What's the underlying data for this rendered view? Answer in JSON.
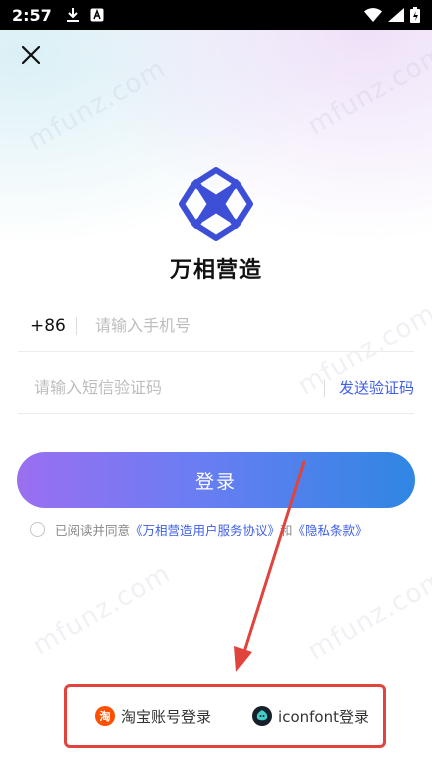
{
  "status_bar": {
    "time": "2:57",
    "left_icons": [
      "download-icon",
      "a-notification-icon"
    ],
    "right_icons": [
      "wifi-icon",
      "signal-icon",
      "battery-icon"
    ]
  },
  "header": {
    "close_icon": "close-icon"
  },
  "brand": {
    "name": "万相营造",
    "logo_color": "#3d4fd6"
  },
  "form": {
    "country_code": "+86",
    "phone_placeholder": "请输入手机号",
    "code_placeholder": "请输入短信验证码",
    "send_code_label": "发送验证码"
  },
  "login_button": {
    "label": "登录"
  },
  "agreement": {
    "prefix": "已阅读并同意",
    "user_agreement": "《万相营造用户服务协议》",
    "conjunction": "和",
    "privacy_policy": "《隐私条款》",
    "link_color": "#3d5ee8"
  },
  "social_login": {
    "taobao": {
      "icon_text": "淘",
      "label": "淘宝账号登录"
    },
    "iconfont": {
      "label": "iconfont登录"
    }
  },
  "annotation": {
    "color": "#e0443c"
  },
  "watermark": {
    "text": "mfunz.com"
  }
}
